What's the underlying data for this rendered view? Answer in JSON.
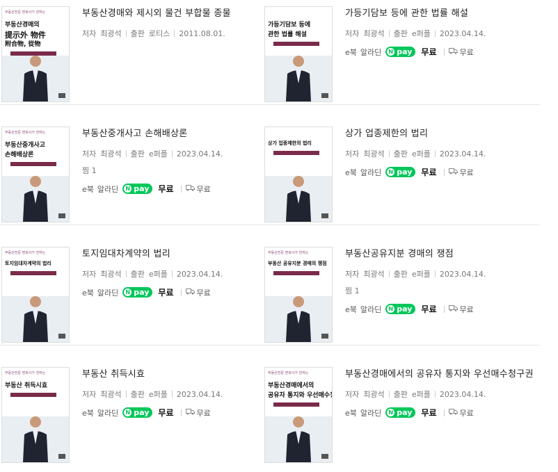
{
  "books": [
    {
      "title": "부동산경매와 제시외 물건 부합물 종물",
      "author_label": "저자",
      "author": "최광석",
      "publisher_label": "출판",
      "publisher": "로티스",
      "date": "2011.08.01.",
      "ebook": false,
      "cover": {
        "series": "부동산전문 변호사가 전하는",
        "title_lines": [
          "부동산경매의",
          "提示外 物件",
          "附合物, 從物"
        ]
      }
    },
    {
      "title": "가등기담보 등에 관한 법률 해설",
      "author_label": "저자",
      "author": "최광석",
      "publisher_label": "출판",
      "publisher": "e퍼플",
      "date": "2023.04.14.",
      "ebook": true,
      "cover": {
        "series": "",
        "title_lines": [
          "가등기담보 등에",
          "관한 법률 해설"
        ]
      }
    },
    {
      "title": "부동산중개사고 손해배상론",
      "author_label": "저자",
      "author": "최광석",
      "publisher_label": "출판",
      "publisher": "e퍼플",
      "date": "2023.04.14.",
      "wish": "찜 1",
      "ebook": true,
      "cover": {
        "series": "부동산전문 변호사가 전하는",
        "title_lines": [
          "부동산중개사고",
          "손해배상론"
        ]
      }
    },
    {
      "title": "상가 업종제한의 법리",
      "author_label": "저자",
      "author": "최광석",
      "publisher_label": "출판",
      "publisher": "e퍼플",
      "date": "2023.04.14.",
      "ebook": true,
      "cover": {
        "series": "",
        "title_lines": [
          "상가 업종제한의 법리"
        ]
      }
    },
    {
      "title": "토지임대차계약의 법리",
      "author_label": "저자",
      "author": "최광석",
      "publisher_label": "출판",
      "publisher": "e퍼플",
      "date": "2023.04.14.",
      "ebook": true,
      "cover": {
        "series": "부동산전문 변호사가 전하는",
        "title_lines": [
          "토지임대차계약의 법리"
        ]
      }
    },
    {
      "title": "부동산공유지분 경매의 쟁점",
      "author_label": "저자",
      "author": "최광석",
      "publisher_label": "출판",
      "publisher": "e퍼플",
      "date": "2023.04.14.",
      "wish": "찜 1",
      "ebook": true,
      "cover": {
        "series": "부동산전문 변호사가 전하는",
        "title_lines": [
          "부동산 공유지분 경매의 쟁점"
        ]
      }
    },
    {
      "title": "부동산 취득시효",
      "author_label": "저자",
      "author": "최광석",
      "publisher_label": "출판",
      "publisher": "e퍼플",
      "date": "2023.04.14.",
      "ebook": true,
      "cover": {
        "series": "부동산전문 변호사가 전하는",
        "title_lines": [
          "부동산 취득시효"
        ]
      }
    },
    {
      "title": "부동산경매에서의 공유자 통지와 우선매수청구권",
      "author_label": "저자",
      "author": "최광석",
      "publisher_label": "출판",
      "publisher": "e퍼플",
      "date": "2023.04.14.",
      "ebook": true,
      "cover": {
        "series": "부동산전문 변호사가 전하는",
        "title_lines": [
          "부동산경매에서의",
          "공유자 통지와 우선매수청구권"
        ]
      }
    }
  ],
  "buy": {
    "type": "e북",
    "store": "알라딘",
    "npay": "pay",
    "price": "무료",
    "shipping": "무료"
  },
  "colors": {
    "npay": "#03c75a",
    "divider": "#e6e6e6"
  }
}
